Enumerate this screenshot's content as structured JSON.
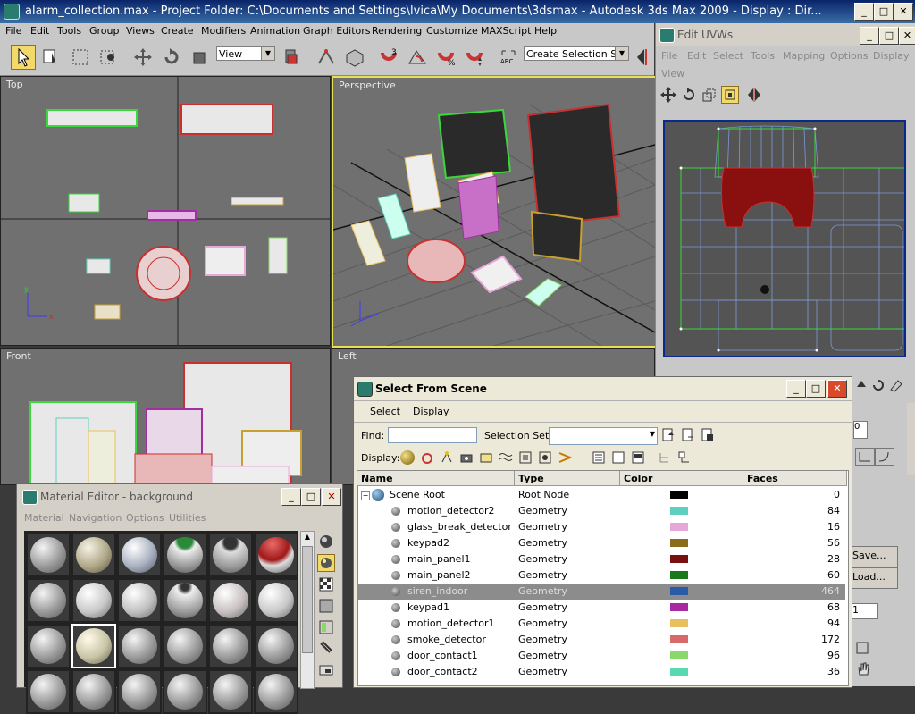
{
  "window": {
    "title": "alarm_collection.max      - Project Folder: C:\\Documents and Settings\\lvica\\My Documents\\3dsmax     - Autodesk 3ds Max  2009      - Display : Dir..."
  },
  "menubar": [
    "File",
    "Edit",
    "Tools",
    "Group",
    "Views",
    "Create",
    "Modifiers",
    "Animation",
    "Graph Editors",
    "Rendering",
    "Customize",
    "MAXScript",
    "Help"
  ],
  "toolbar": {
    "view_combo": "View",
    "selection_set_combo": "Create Selection Set"
  },
  "viewports": {
    "top": "Top",
    "perspective": "Perspective",
    "front": "Front",
    "left": "Left"
  },
  "uvw": {
    "title": "Edit UVWs",
    "menu": [
      "File",
      "Edit",
      "Select",
      "Tools",
      "Mapping",
      "Options",
      "Display",
      "View"
    ]
  },
  "select_from_scene": {
    "title": "Select From Scene",
    "menu": [
      "Select",
      "Display"
    ],
    "find_label": "Find:",
    "find_value": "",
    "selection_set_label": "Selection Set:",
    "selection_set_value": "",
    "display_label": "Display:",
    "columns": [
      "Name",
      "Type",
      "Color",
      "Faces"
    ],
    "root": {
      "name": "Scene Root",
      "type": "Root Node",
      "color": "#000000",
      "faces": "0"
    },
    "rows": [
      {
        "name": "motion_detector2",
        "type": "Geometry",
        "color": "#5fcfbf",
        "faces": "84"
      },
      {
        "name": "glass_break_detector",
        "type": "Geometry",
        "color": "#e6a8d8",
        "faces": "16"
      },
      {
        "name": "keypad2",
        "type": "Geometry",
        "color": "#8a6d1a",
        "faces": "56"
      },
      {
        "name": "main_panel1",
        "type": "Geometry",
        "color": "#7a1010",
        "faces": "28"
      },
      {
        "name": "main_panel2",
        "type": "Geometry",
        "color": "#1a7a1a",
        "faces": "60"
      },
      {
        "name": "siren_indoor",
        "type": "Geometry",
        "color": "#2a5aa8",
        "faces": "464",
        "selected": true
      },
      {
        "name": "keypad1",
        "type": "Geometry",
        "color": "#a82aa0",
        "faces": "68"
      },
      {
        "name": "motion_detector1",
        "type": "Geometry",
        "color": "#e8c060",
        "faces": "94"
      },
      {
        "name": "smoke_detector",
        "type": "Geometry",
        "color": "#d86a6a",
        "faces": "172"
      },
      {
        "name": "door_contact1",
        "type": "Geometry",
        "color": "#8ad86a",
        "faces": "96"
      },
      {
        "name": "door_contact2",
        "type": "Geometry",
        "color": "#5ad8b0",
        "faces": "36"
      }
    ]
  },
  "material_editor": {
    "title": "Material Editor - background",
    "menu": [
      "Material",
      "Navigation",
      "Options",
      "Utilities"
    ]
  },
  "side_panel": {
    "save_label": "Save...",
    "load_label": "Load...",
    "spinner_value": "1",
    "spinner_value2": "0"
  }
}
